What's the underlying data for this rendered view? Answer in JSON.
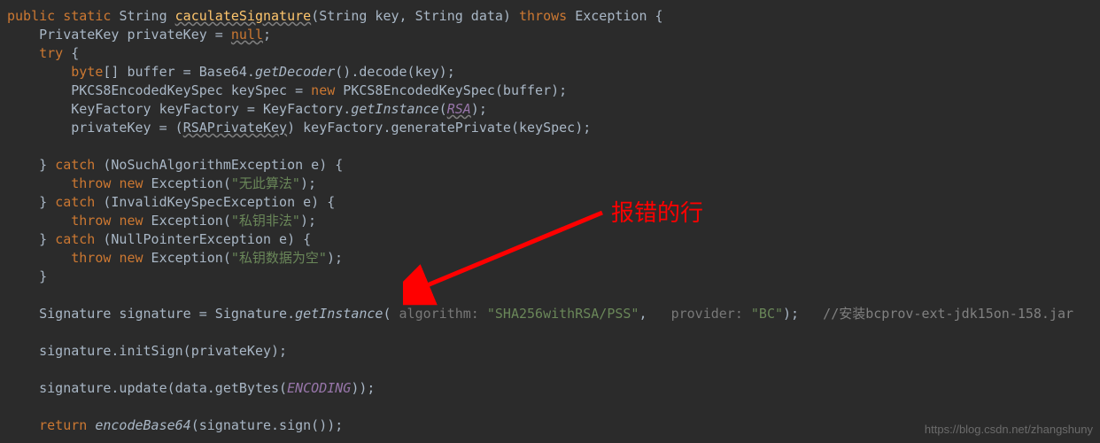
{
  "code": {
    "l1": {
      "public": "public",
      "static": "static",
      "String": "String",
      "methodName": "caculateSignature",
      "params": "(String key, String data)",
      "throws": "throws",
      "Exception": "Exception {"
    },
    "l2": {
      "text1": "    PrivateKey privateKey = ",
      "null": "null",
      "semi": ";"
    },
    "l3": {
      "try": "    try",
      "brace": " {"
    },
    "l4": {
      "indent": "        ",
      "byte": "byte",
      "arr": "[] buffer = Base64.",
      "getDecoder": "getDecoder",
      "rest": "().decode(key);"
    },
    "l5": {
      "indent": "        PKCS8EncodedKeySpec keySpec = ",
      "new": "new",
      "rest": " PKCS8EncodedKeySpec(buffer);"
    },
    "l6": {
      "indent": "        KeyFactory keyFactory = KeyFactory.",
      "getInstance": "getInstance",
      "p1": "(",
      "RSA": "RSA",
      "p2": ");"
    },
    "l7": {
      "indent": "        privateKey = (",
      "RSAPrivateKey": "RSAPrivateKey",
      "rest": ") keyFactory.generatePrivate(keySpec);"
    },
    "l8": "",
    "l9": {
      "indent": "    } ",
      "catch": "catch",
      "rest": " (NoSuchAlgorithmException e) {"
    },
    "l10": {
      "indent": "        ",
      "throw": "throw",
      "sp": " ",
      "new": "new",
      "exc": " Exception(",
      "str": "\"无此算法\"",
      "end": ");"
    },
    "l11": {
      "indent": "    } ",
      "catch": "catch",
      "rest": " (InvalidKeySpecException e) {"
    },
    "l12": {
      "indent": "        ",
      "throw": "throw",
      "sp": " ",
      "new": "new",
      "exc": " Exception(",
      "str": "\"私钥非法\"",
      "end": ");"
    },
    "l13": {
      "indent": "    } ",
      "catch": "catch",
      "rest": " (NullPointerException e) {"
    },
    "l14": {
      "indent": "        ",
      "throw": "throw",
      "sp": " ",
      "new": "new",
      "exc": " Exception(",
      "str": "\"私钥数据为空\"",
      "end": ");"
    },
    "l15": "    }",
    "l16": "",
    "l17": {
      "indent": "    Signature signature = Signature.",
      "getInstance": "getInstance",
      "p1": "( ",
      "h1": "algorithm:",
      "sp1": " ",
      "s1": "\"SHA256withRSA/PSS\"",
      "comma": ",   ",
      "h2": "provider:",
      "sp2": " ",
      "s2": "\"BC\"",
      "p2": ");   ",
      "comment": "//安装bcprov-ext-jdk15on-158.jar"
    },
    "l18": "",
    "l19": "    signature.initSign(privateKey);",
    "l20": "",
    "l21": {
      "indent": "    signature.update(data.getBytes(",
      "ENCODING": "ENCODING",
      "end": "));"
    },
    "l22": "",
    "l23": {
      "indent": "    ",
      "return": "return",
      "sp": " ",
      "encodeBase64": "encodeBase64",
      "rest": "(signature.sign());"
    }
  },
  "annotation": {
    "text": "报错的行"
  },
  "watermark": "https://blog.csdn.net/zhangshuny"
}
